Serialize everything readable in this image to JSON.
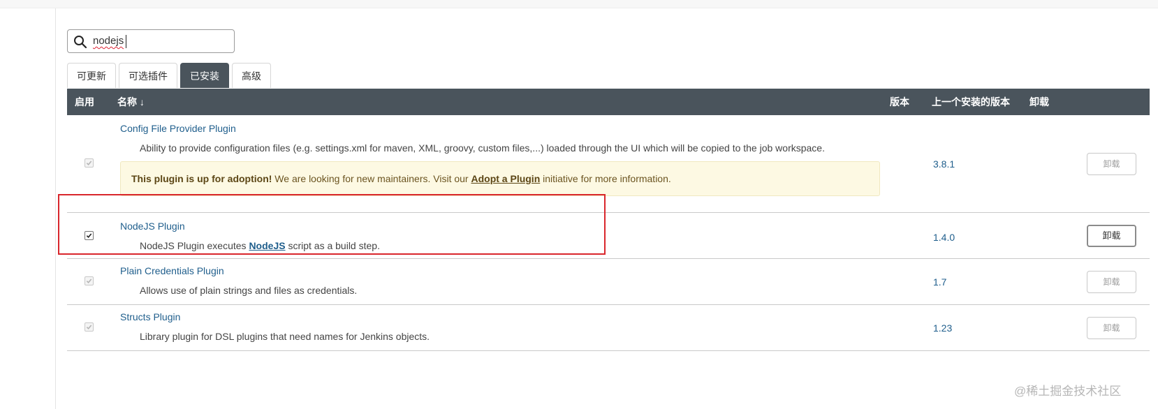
{
  "search": {
    "value": "nodejs"
  },
  "tabs": [
    {
      "label": "可更新",
      "active": false
    },
    {
      "label": "可选插件",
      "active": false
    },
    {
      "label": "已安装",
      "active": true
    },
    {
      "label": "高级",
      "active": false
    }
  ],
  "table": {
    "headers": {
      "enabled": "启用",
      "name": "名称 ↓",
      "version": "版本",
      "previous": "上一个安装的版本",
      "uninstall": "卸载"
    },
    "rows": [
      {
        "name": "Config File Provider Plugin",
        "description": "Ability to provide configuration files (e.g. settings.xml for maven, XML, groovy, custom files,...) loaded through the UI which will be copied to the job workspace.",
        "adoption": {
          "strong": "This plugin is up for adoption!",
          "text_before": " We are looking for new maintainers. Visit our ",
          "link": "Adopt a Plugin",
          "text_after": " initiative for more information."
        },
        "version": "3.8.1",
        "checked": true,
        "disabled": true,
        "uninstall_label": "卸载",
        "uninstall_enabled": false
      },
      {
        "name": "NodeJS Plugin",
        "description_before": "NodeJS Plugin executes ",
        "description_link": "NodeJS",
        "description_after": " script as a build step.",
        "version": "1.4.0",
        "checked": true,
        "disabled": false,
        "uninstall_label": "卸载",
        "uninstall_enabled": true
      },
      {
        "name": "Plain Credentials Plugin",
        "description": "Allows use of plain strings and files as credentials.",
        "version": "1.7",
        "checked": true,
        "disabled": true,
        "uninstall_label": "卸载",
        "uninstall_enabled": false
      },
      {
        "name": "Structs Plugin",
        "description": "Library plugin for DSL plugins that need names for Jenkins objects.",
        "version": "1.23",
        "checked": true,
        "disabled": true,
        "uninstall_label": "卸载",
        "uninstall_enabled": false
      }
    ]
  },
  "watermark": "@稀土掘金技术社区",
  "colors": {
    "header_bg": "#4a545c",
    "link": "#1f5e8c",
    "adoption_bg": "#fdf9e3",
    "highlight": "#d9262c"
  }
}
